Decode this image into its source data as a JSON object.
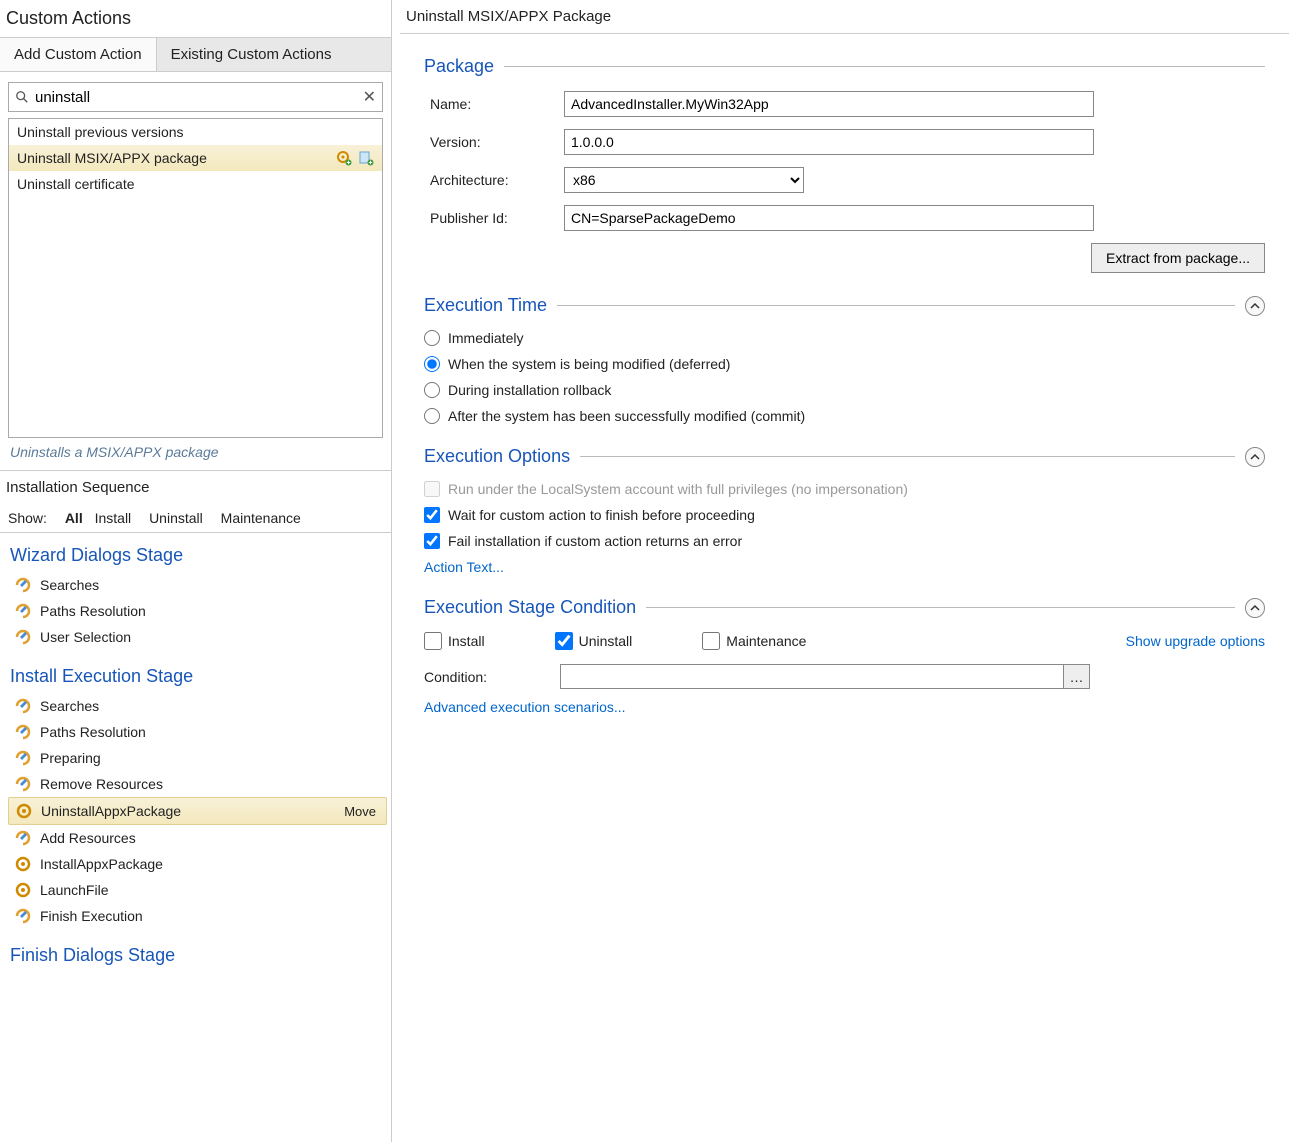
{
  "page_title": "Custom Actions",
  "tabs": {
    "add": "Add Custom Action",
    "existing": "Existing Custom Actions"
  },
  "search": {
    "value": "uninstall"
  },
  "results": [
    {
      "label": "Uninstall previous versions",
      "selected": false
    },
    {
      "label": "Uninstall MSIX/APPX package",
      "selected": true
    },
    {
      "label": "Uninstall certificate",
      "selected": false
    }
  ],
  "hint": "Uninstalls a MSIX/APPX package",
  "seq_header": "Installation Sequence",
  "filters": {
    "show": "Show:",
    "all": "All",
    "install": "Install",
    "uninstall": "Uninstall",
    "maintenance": "Maintenance"
  },
  "stages": {
    "wizard": {
      "title": "Wizard Dialogs Stage",
      "items": [
        "Searches",
        "Paths Resolution",
        "User Selection"
      ]
    },
    "install_exec": {
      "title": "Install Execution Stage",
      "items": [
        {
          "label": "Searches",
          "kind": "step"
        },
        {
          "label": "Paths Resolution",
          "kind": "step"
        },
        {
          "label": "Preparing",
          "kind": "step"
        },
        {
          "label": "Remove Resources",
          "kind": "step"
        },
        {
          "label": "UninstallAppxPackage",
          "kind": "ca",
          "selected": true,
          "move": "Move"
        },
        {
          "label": "Add Resources",
          "kind": "step"
        },
        {
          "label": "InstallAppxPackage",
          "kind": "ca"
        },
        {
          "label": "LaunchFile",
          "kind": "ca"
        },
        {
          "label": "Finish Execution",
          "kind": "step"
        }
      ]
    },
    "finish": {
      "title": "Finish Dialogs Stage"
    }
  },
  "right_title": "Uninstall MSIX/APPX Package",
  "package": {
    "section": "Package",
    "name_label": "Name:",
    "name_value": "AdvancedInstaller.MyWin32App",
    "version_label": "Version:",
    "version_value": "1.0.0.0",
    "arch_label": "Architecture:",
    "arch_value": "x86",
    "pub_label": "Publisher Id:",
    "pub_value": "CN=SparsePackageDemo",
    "extract_btn": "Extract from package..."
  },
  "exec_time": {
    "section": "Execution Time",
    "opts": [
      "Immediately",
      "When the system is being modified (deferred)",
      "During installation rollback",
      "After the system has been successfully modified (commit)"
    ],
    "selected": 1
  },
  "exec_opts": {
    "section": "Execution Options",
    "localsystem": "Run under the LocalSystem account with full privileges (no impersonation)",
    "wait": "Wait for custom action to finish before proceeding",
    "fail": "Fail installation if custom action returns an error",
    "action_text": "Action Text..."
  },
  "stage_cond": {
    "section": "Execution Stage Condition",
    "install": "Install",
    "uninstall": "Uninstall",
    "maintenance": "Maintenance",
    "show_upgrade": "Show upgrade options",
    "condition_label": "Condition:",
    "condition_value": "",
    "advanced": "Advanced execution scenarios..."
  }
}
